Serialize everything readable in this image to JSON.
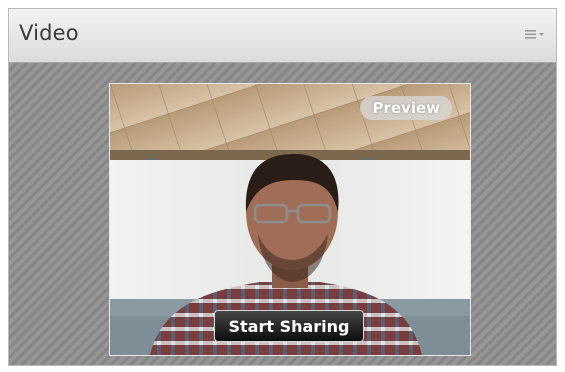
{
  "pod": {
    "title": "Video",
    "menu_icon": "list-menu-icon"
  },
  "video": {
    "preview_label": "Preview",
    "start_sharing_label": "Start Sharing"
  }
}
